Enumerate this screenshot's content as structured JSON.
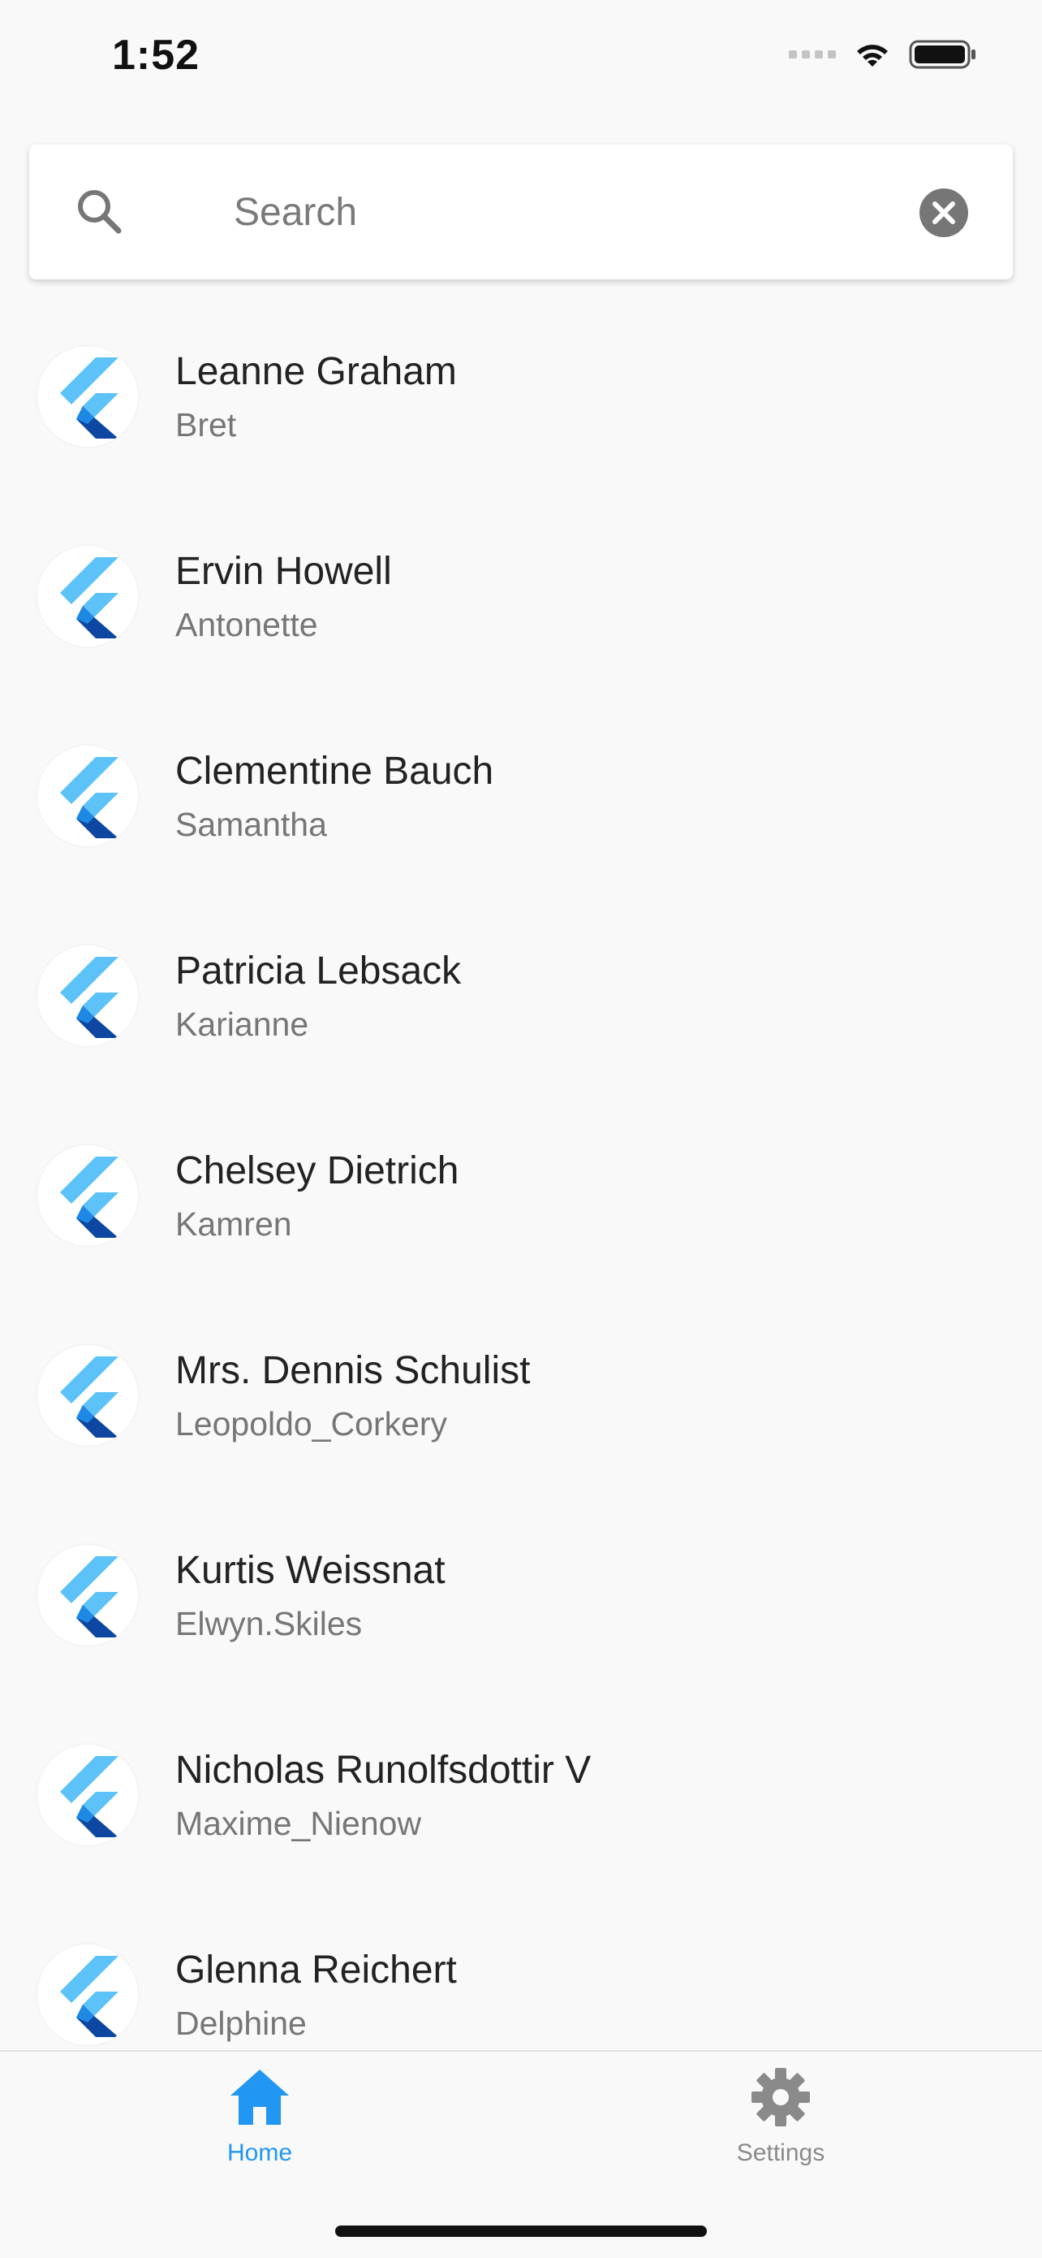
{
  "status_bar": {
    "time": "1:52"
  },
  "search": {
    "placeholder": "Search",
    "value": ""
  },
  "users": [
    {
      "name": "Leanne Graham",
      "username": "Bret"
    },
    {
      "name": "Ervin Howell",
      "username": "Antonette"
    },
    {
      "name": "Clementine Bauch",
      "username": "Samantha"
    },
    {
      "name": "Patricia Lebsack",
      "username": "Karianne"
    },
    {
      "name": "Chelsey Dietrich",
      "username": "Kamren"
    },
    {
      "name": "Mrs. Dennis Schulist",
      "username": "Leopoldo_Corkery"
    },
    {
      "name": "Kurtis Weissnat",
      "username": "Elwyn.Skiles"
    },
    {
      "name": "Nicholas Runolfsdottir V",
      "username": "Maxime_Nienow"
    },
    {
      "name": "Glenna Reichert",
      "username": "Delphine"
    }
  ],
  "avatar_icon": "flutter-logo-icon",
  "bottom_nav": {
    "items": [
      {
        "label": "Home",
        "icon": "home-icon",
        "active": true
      },
      {
        "label": "Settings",
        "icon": "gear-icon",
        "active": false
      }
    ]
  },
  "colors": {
    "accent": "#2196f3",
    "inactive": "#8a8a8a",
    "background": "#f9f9fa"
  }
}
